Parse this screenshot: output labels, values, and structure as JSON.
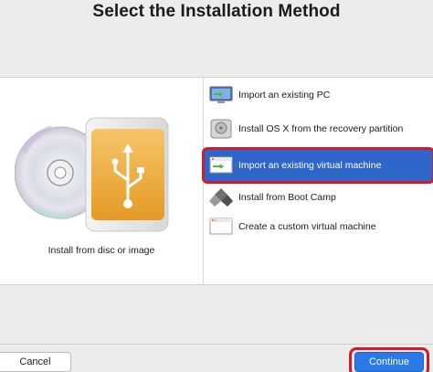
{
  "dialog": {
    "title": "Select the Installation Method"
  },
  "left_option": {
    "caption": "Install from disc or image",
    "icon": "disc-and-usb-drive-icon"
  },
  "methods": [
    {
      "label": "Import an existing PC",
      "icon": "pc-migration-icon",
      "selected": false
    },
    {
      "label": "Install OS X from the recovery partition",
      "icon": "hard-disk-icon",
      "selected": false
    },
    {
      "label": "Import an existing virtual machine",
      "icon": "vm-import-icon",
      "selected": true
    },
    {
      "label": "Install from Boot Camp",
      "icon": "boot-camp-icon",
      "selected": false
    },
    {
      "label": "Create a custom virtual machine",
      "icon": "custom-vm-icon",
      "selected": false
    }
  ],
  "buttons": {
    "cancel": "Cancel",
    "continue": "Continue"
  },
  "colors": {
    "selection": "#2f66c9",
    "highlight_frame": "#d31a2a",
    "primary_button": "#2b79e6"
  }
}
